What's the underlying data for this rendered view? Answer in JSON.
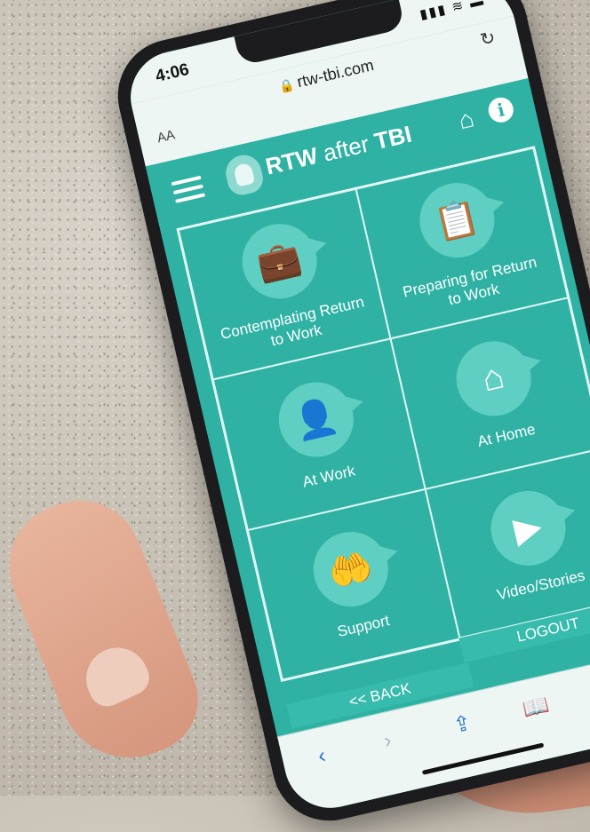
{
  "status": {
    "time": "4:06",
    "icons": "▮▮▮ ≋ ▬"
  },
  "browser": {
    "text_size_label": "AA",
    "url": "rtw-tbi.com",
    "reload_glyph": "↻"
  },
  "app": {
    "brand_bold": "RTW",
    "brand_rest": " after ",
    "brand_bold2": "TBI",
    "home_glyph": "⌂",
    "info_glyph": "i"
  },
  "tiles": [
    {
      "label": "Contemplating Return to Work",
      "icon": "briefcase-icon",
      "glyph": "💼"
    },
    {
      "label": "Preparing for Return to Work",
      "icon": "clipboard-icon",
      "glyph": "📋"
    },
    {
      "label": "At Work",
      "icon": "worker-icon",
      "glyph": "👤"
    },
    {
      "label": "At Home",
      "icon": "house-icon",
      "glyph": "⌂"
    },
    {
      "label": "Support",
      "icon": "helping-hand-icon",
      "glyph": "🤲"
    },
    {
      "label": "Video/Stories",
      "icon": "play-icon",
      "glyph": "▶"
    }
  ],
  "footer": {
    "logout": "LOGOUT",
    "back": "<< BACK"
  },
  "toolbar": {
    "back": "‹",
    "forward": "›",
    "share": "⇪",
    "bookmarks": "📖",
    "tabs": "❐"
  },
  "colors": {
    "teal": "#2fb2a4",
    "bubble": "#5ecfc2",
    "ios_blue": "#1f6fd6"
  }
}
